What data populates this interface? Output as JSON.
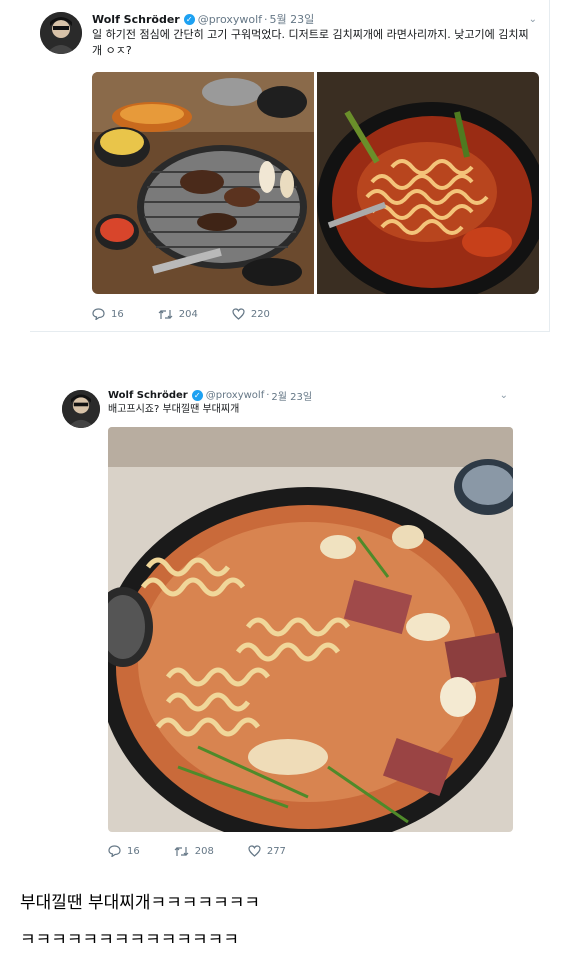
{
  "tweet1": {
    "name": "Wolf Schröder",
    "handle": "@proxywolf",
    "date": "5월 23일",
    "text": "일 하기전 점심에 간단히 고기 구워먹었다. 디저트로 김치찌개에 라면사리까지. 낮고기에 김치찌개 ㅇㅈ?",
    "replies": "16",
    "retweets": "204",
    "likes": "220"
  },
  "tweet2": {
    "name": "Wolf Schröder",
    "handle": "@proxywolf",
    "date": "2월 23일",
    "text": "배고프시죠? 부대낄땐 부대찌개",
    "replies": "16",
    "retweets": "208",
    "likes": "277"
  },
  "comment": {
    "line1": "부대낄땐 부대찌개ㅋㅋㅋㅋㅋㅋㅋ",
    "line2": "ㅋㅋㅋㅋㅋㅋㅋㅋㅋㅋㅋㅋㅋㅋ"
  },
  "icons": {
    "verified": "verified-badge-icon",
    "reply": "reply-icon",
    "retweet": "retweet-icon",
    "like": "heart-icon",
    "menu": "chevron-down-icon"
  },
  "colors": {
    "verified": "#1da1f2",
    "muted": "#657786",
    "text": "#14171a"
  }
}
